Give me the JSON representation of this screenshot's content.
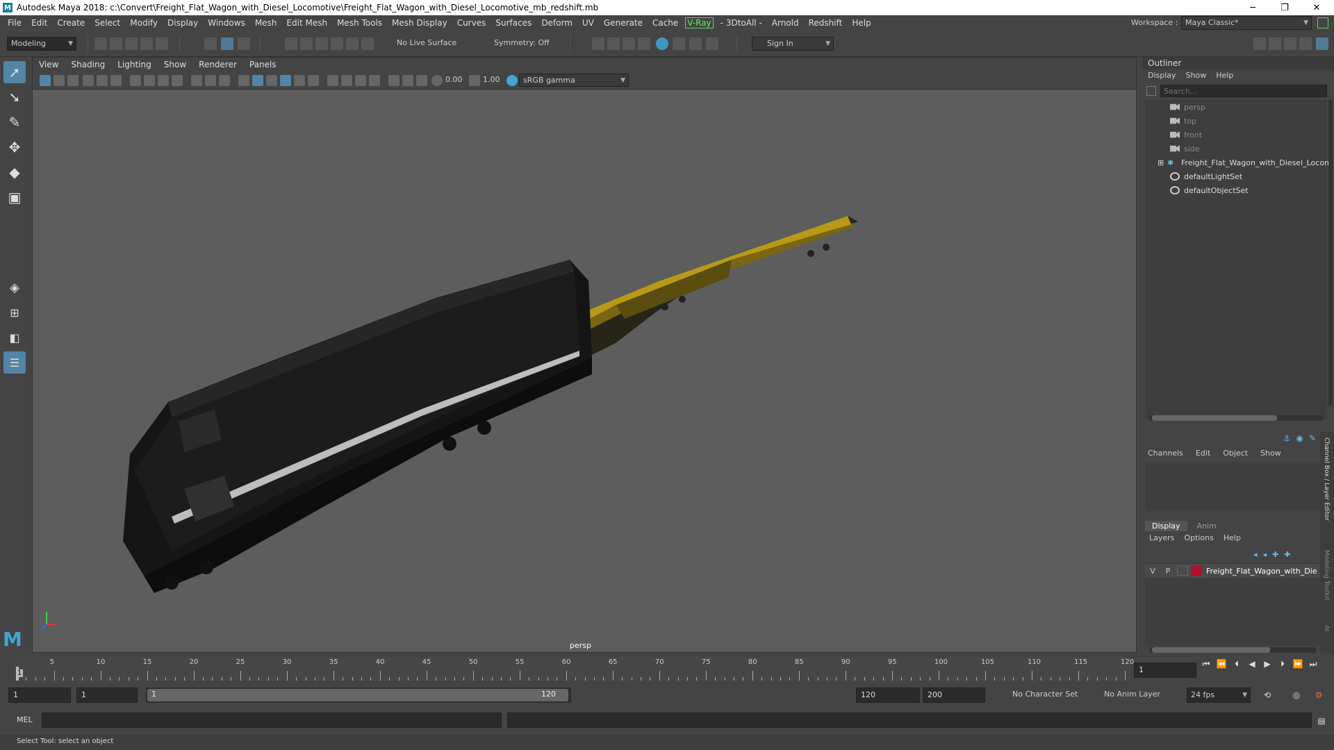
{
  "window": {
    "title": "Autodesk Maya 2018: c:\\Convert\\Freight_Flat_Wagon_with_Diesel_Locomotive\\Freight_Flat_Wagon_with_Diesel_Locomotive_mb_redshift.mb",
    "minimize": "─",
    "maximize": "❐",
    "close": "✕"
  },
  "menubar": {
    "items": [
      "File",
      "Edit",
      "Create",
      "Select",
      "Modify",
      "Display",
      "Windows",
      "Mesh",
      "Edit Mesh",
      "Mesh Tools",
      "Mesh Display",
      "Curves",
      "Surfaces",
      "Deform",
      "UV",
      "Generate",
      "Cache"
    ],
    "vray": "V-Ray",
    "items2": [
      "- 3DtoAll -",
      "Arnold",
      "Redshift",
      "Help"
    ],
    "workspace_label": "Workspace :",
    "workspace_value": "Maya Classic*"
  },
  "toolbar": {
    "mode": "Modeling",
    "live_surface": "No Live Surface",
    "symmetry": "Symmetry: Off",
    "sign_in": "Sign In"
  },
  "viewport": {
    "menus": [
      "View",
      "Shading",
      "Lighting",
      "Show",
      "Renderer",
      "Panels"
    ],
    "exposure": "0.00",
    "gamma": "1.00",
    "color_space": "sRGB gamma",
    "camera_label": "persp"
  },
  "outliner": {
    "title": "Outliner",
    "menus": [
      "Display",
      "Show",
      "Help"
    ],
    "search_placeholder": "Search...",
    "items": [
      {
        "label": "persp",
        "icon": "camera-icon"
      },
      {
        "label": "top",
        "icon": "camera-icon"
      },
      {
        "label": "front",
        "icon": "camera-icon"
      },
      {
        "label": "side",
        "icon": "camera-icon"
      },
      {
        "label": "Freight_Flat_Wagon_with_Diesel_Locom",
        "icon": "group-icon",
        "expand": "⊞"
      },
      {
        "label": "defaultLightSet",
        "icon": "set-icon"
      },
      {
        "label": "defaultObjectSet",
        "icon": "set-icon"
      }
    ]
  },
  "channelbox": {
    "menus": [
      "Channels",
      "Edit",
      "Object",
      "Show"
    ]
  },
  "layereditor": {
    "tabs": [
      "Display",
      "Anim"
    ],
    "menus": [
      "Layers",
      "Options",
      "Help"
    ],
    "layer": {
      "v": "V",
      "p": "P",
      "name": "Freight_Flat_Wagon_with_Die",
      "color": "#b0102a"
    },
    "side_label": "Channel Box / Layer Editor",
    "side_label2": "Modeling Toolkit",
    "side_label3": "At"
  },
  "timeline": {
    "ticks": [
      5,
      10,
      15,
      20,
      25,
      30,
      35,
      40,
      45,
      50,
      55,
      60,
      65,
      70,
      75,
      80,
      85,
      90,
      95,
      100,
      105,
      110,
      115,
      120
    ],
    "current_frame": "1",
    "current_field": "1"
  },
  "range": {
    "start": "1",
    "start2": "1",
    "slider_start": "1",
    "slider_end": "120",
    "end": "120",
    "end2": "200",
    "character_set": "No Character Set",
    "anim_layer": "No Anim Layer",
    "fps": "24 fps"
  },
  "cmdline": {
    "label": "MEL"
  },
  "helpline": {
    "text": "Select Tool: select an object"
  }
}
